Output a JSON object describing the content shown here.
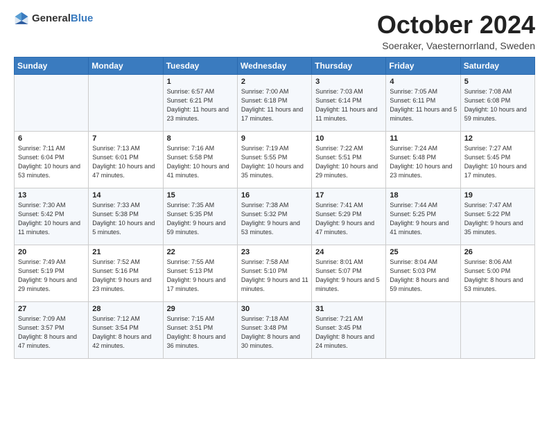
{
  "header": {
    "logo_general": "General",
    "logo_blue": "Blue",
    "month_title": "October 2024",
    "subtitle": "Soeraker, Vaesternorrland, Sweden"
  },
  "weekdays": [
    "Sunday",
    "Monday",
    "Tuesday",
    "Wednesday",
    "Thursday",
    "Friday",
    "Saturday"
  ],
  "weeks": [
    [
      {
        "day": "",
        "sunrise": "",
        "sunset": "",
        "daylight": ""
      },
      {
        "day": "",
        "sunrise": "",
        "sunset": "",
        "daylight": ""
      },
      {
        "day": "1",
        "sunrise": "Sunrise: 6:57 AM",
        "sunset": "Sunset: 6:21 PM",
        "daylight": "Daylight: 11 hours and 23 minutes."
      },
      {
        "day": "2",
        "sunrise": "Sunrise: 7:00 AM",
        "sunset": "Sunset: 6:18 PM",
        "daylight": "Daylight: 11 hours and 17 minutes."
      },
      {
        "day": "3",
        "sunrise": "Sunrise: 7:03 AM",
        "sunset": "Sunset: 6:14 PM",
        "daylight": "Daylight: 11 hours and 11 minutes."
      },
      {
        "day": "4",
        "sunrise": "Sunrise: 7:05 AM",
        "sunset": "Sunset: 6:11 PM",
        "daylight": "Daylight: 11 hours and 5 minutes."
      },
      {
        "day": "5",
        "sunrise": "Sunrise: 7:08 AM",
        "sunset": "Sunset: 6:08 PM",
        "daylight": "Daylight: 10 hours and 59 minutes."
      }
    ],
    [
      {
        "day": "6",
        "sunrise": "Sunrise: 7:11 AM",
        "sunset": "Sunset: 6:04 PM",
        "daylight": "Daylight: 10 hours and 53 minutes."
      },
      {
        "day": "7",
        "sunrise": "Sunrise: 7:13 AM",
        "sunset": "Sunset: 6:01 PM",
        "daylight": "Daylight: 10 hours and 47 minutes."
      },
      {
        "day": "8",
        "sunrise": "Sunrise: 7:16 AM",
        "sunset": "Sunset: 5:58 PM",
        "daylight": "Daylight: 10 hours and 41 minutes."
      },
      {
        "day": "9",
        "sunrise": "Sunrise: 7:19 AM",
        "sunset": "Sunset: 5:55 PM",
        "daylight": "Daylight: 10 hours and 35 minutes."
      },
      {
        "day": "10",
        "sunrise": "Sunrise: 7:22 AM",
        "sunset": "Sunset: 5:51 PM",
        "daylight": "Daylight: 10 hours and 29 minutes."
      },
      {
        "day": "11",
        "sunrise": "Sunrise: 7:24 AM",
        "sunset": "Sunset: 5:48 PM",
        "daylight": "Daylight: 10 hours and 23 minutes."
      },
      {
        "day": "12",
        "sunrise": "Sunrise: 7:27 AM",
        "sunset": "Sunset: 5:45 PM",
        "daylight": "Daylight: 10 hours and 17 minutes."
      }
    ],
    [
      {
        "day": "13",
        "sunrise": "Sunrise: 7:30 AM",
        "sunset": "Sunset: 5:42 PM",
        "daylight": "Daylight: 10 hours and 11 minutes."
      },
      {
        "day": "14",
        "sunrise": "Sunrise: 7:33 AM",
        "sunset": "Sunset: 5:38 PM",
        "daylight": "Daylight: 10 hours and 5 minutes."
      },
      {
        "day": "15",
        "sunrise": "Sunrise: 7:35 AM",
        "sunset": "Sunset: 5:35 PM",
        "daylight": "Daylight: 9 hours and 59 minutes."
      },
      {
        "day": "16",
        "sunrise": "Sunrise: 7:38 AM",
        "sunset": "Sunset: 5:32 PM",
        "daylight": "Daylight: 9 hours and 53 minutes."
      },
      {
        "day": "17",
        "sunrise": "Sunrise: 7:41 AM",
        "sunset": "Sunset: 5:29 PM",
        "daylight": "Daylight: 9 hours and 47 minutes."
      },
      {
        "day": "18",
        "sunrise": "Sunrise: 7:44 AM",
        "sunset": "Sunset: 5:25 PM",
        "daylight": "Daylight: 9 hours and 41 minutes."
      },
      {
        "day": "19",
        "sunrise": "Sunrise: 7:47 AM",
        "sunset": "Sunset: 5:22 PM",
        "daylight": "Daylight: 9 hours and 35 minutes."
      }
    ],
    [
      {
        "day": "20",
        "sunrise": "Sunrise: 7:49 AM",
        "sunset": "Sunset: 5:19 PM",
        "daylight": "Daylight: 9 hours and 29 minutes."
      },
      {
        "day": "21",
        "sunrise": "Sunrise: 7:52 AM",
        "sunset": "Sunset: 5:16 PM",
        "daylight": "Daylight: 9 hours and 23 minutes."
      },
      {
        "day": "22",
        "sunrise": "Sunrise: 7:55 AM",
        "sunset": "Sunset: 5:13 PM",
        "daylight": "Daylight: 9 hours and 17 minutes."
      },
      {
        "day": "23",
        "sunrise": "Sunrise: 7:58 AM",
        "sunset": "Sunset: 5:10 PM",
        "daylight": "Daylight: 9 hours and 11 minutes."
      },
      {
        "day": "24",
        "sunrise": "Sunrise: 8:01 AM",
        "sunset": "Sunset: 5:07 PM",
        "daylight": "Daylight: 9 hours and 5 minutes."
      },
      {
        "day": "25",
        "sunrise": "Sunrise: 8:04 AM",
        "sunset": "Sunset: 5:03 PM",
        "daylight": "Daylight: 8 hours and 59 minutes."
      },
      {
        "day": "26",
        "sunrise": "Sunrise: 8:06 AM",
        "sunset": "Sunset: 5:00 PM",
        "daylight": "Daylight: 8 hours and 53 minutes."
      }
    ],
    [
      {
        "day": "27",
        "sunrise": "Sunrise: 7:09 AM",
        "sunset": "Sunset: 3:57 PM",
        "daylight": "Daylight: 8 hours and 47 minutes."
      },
      {
        "day": "28",
        "sunrise": "Sunrise: 7:12 AM",
        "sunset": "Sunset: 3:54 PM",
        "daylight": "Daylight: 8 hours and 42 minutes."
      },
      {
        "day": "29",
        "sunrise": "Sunrise: 7:15 AM",
        "sunset": "Sunset: 3:51 PM",
        "daylight": "Daylight: 8 hours and 36 minutes."
      },
      {
        "day": "30",
        "sunrise": "Sunrise: 7:18 AM",
        "sunset": "Sunset: 3:48 PM",
        "daylight": "Daylight: 8 hours and 30 minutes."
      },
      {
        "day": "31",
        "sunrise": "Sunrise: 7:21 AM",
        "sunset": "Sunset: 3:45 PM",
        "daylight": "Daylight: 8 hours and 24 minutes."
      },
      {
        "day": "",
        "sunrise": "",
        "sunset": "",
        "daylight": ""
      },
      {
        "day": "",
        "sunrise": "",
        "sunset": "",
        "daylight": ""
      }
    ]
  ]
}
